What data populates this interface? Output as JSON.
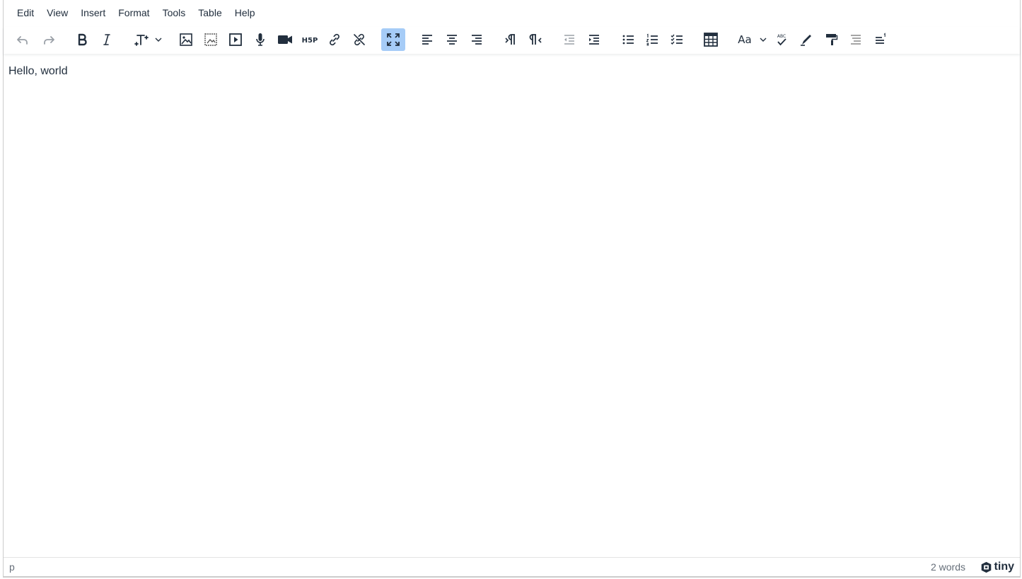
{
  "menubar": {
    "items": [
      {
        "label": "Edit"
      },
      {
        "label": "View"
      },
      {
        "label": "Insert"
      },
      {
        "label": "Format"
      },
      {
        "label": "Tools"
      },
      {
        "label": "Table"
      },
      {
        "label": "Help"
      }
    ]
  },
  "toolbar": {
    "buttons": [
      {
        "name": "undo-icon",
        "state": "disabled"
      },
      {
        "name": "redo-icon",
        "state": "disabled"
      },
      {
        "name": "bold-icon"
      },
      {
        "name": "italic-icon"
      },
      {
        "name": "font-size-icon",
        "has_dropdown": true
      },
      {
        "name": "image-icon"
      },
      {
        "name": "manage-files-icon"
      },
      {
        "name": "media-icon"
      },
      {
        "name": "record-audio-icon"
      },
      {
        "name": "record-video-icon"
      },
      {
        "name": "h5p-icon"
      },
      {
        "name": "link-icon"
      },
      {
        "name": "unlink-icon"
      },
      {
        "name": "fullscreen-icon",
        "state": "active"
      },
      {
        "name": "align-left-icon"
      },
      {
        "name": "align-center-icon"
      },
      {
        "name": "align-right-icon"
      },
      {
        "name": "ltr-icon"
      },
      {
        "name": "rtl-icon"
      },
      {
        "name": "outdent-icon"
      },
      {
        "name": "indent-icon"
      },
      {
        "name": "bullet-list-icon"
      },
      {
        "name": "numbered-list-icon"
      },
      {
        "name": "checklist-icon"
      },
      {
        "name": "table-icon"
      },
      {
        "name": "text-format-icon",
        "has_dropdown": true
      },
      {
        "name": "spellcheck-icon"
      },
      {
        "name": "highlight-icon"
      },
      {
        "name": "format-painter-icon"
      },
      {
        "name": "toc-icon"
      },
      {
        "name": "footnote-icon"
      }
    ],
    "h5p_label": "H5P",
    "abc_label": "ABC",
    "font_label": "Aa"
  },
  "content": {
    "text": "Hello, world"
  },
  "statusbar": {
    "path": "p",
    "wordcount": "2 words",
    "brand": "tiny"
  },
  "colors": {
    "active_button": "#a6ccf7",
    "text": "#222f3e"
  }
}
